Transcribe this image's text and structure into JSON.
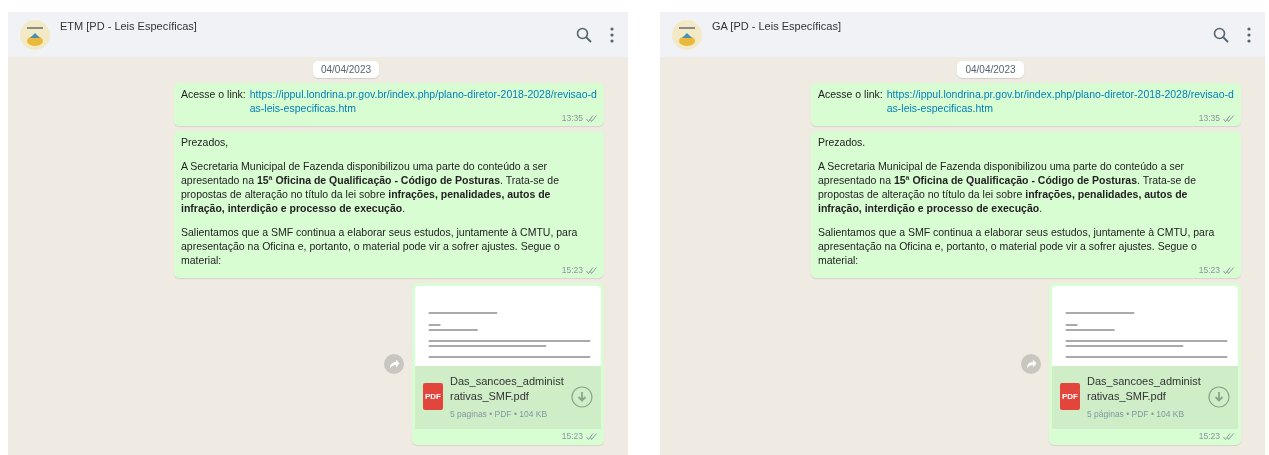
{
  "panels": [
    {
      "header": {
        "title": "ETM [PD - Leis Específicas]"
      },
      "date_chip": "04/04/2023",
      "messages": [
        {
          "kind": "link",
          "prefix": "Acesse o link:",
          "link": "https://ippul.londrina.pr.gov.br/index.php/plano-diretor-2018-2028/revisao-das-leis-especificas.htm",
          "time": "13:35"
        },
        {
          "kind": "text",
          "paragraphs": [
            "Prezados,",
            "A Secretaria Municipal de Fazenda disponibilizou uma parte do conteúdo a ser apresentado na **15ª Oficina de Qualificação - Código de Posturas**. Trata-se de propostas de alteração no título da lei sobre **infrações, penalidades, autos de infração, interdição e processo de execução**.",
            "Salientamos que a SMF continua a elaborar seus estudos, juntamente à CMTU, para apresentação na Oficina e, portanto, o material pode vir a sofrer ajustes. Segue o material:"
          ],
          "time": "15:23"
        },
        {
          "kind": "document",
          "file_type": "PDF",
          "file_name": "Das_sancoes_administrativas_SMF.pdf",
          "meta": "5 paginas • PDF • 104 KB",
          "time": "15:23"
        }
      ]
    },
    {
      "header": {
        "title": "GA [PD - Leis Específicas]"
      },
      "date_chip": "04/04/2023",
      "messages": [
        {
          "kind": "link",
          "prefix": "Acesse o link:",
          "link": "https://ippul.londrina.pr.gov.br/index.php/plano-diretor-2018-2028/revisao-das-leis-especificas.htm",
          "time": "13:35"
        },
        {
          "kind": "text",
          "paragraphs": [
            "Prezados.",
            "A Secretaria Municipal de Fazenda disponibilizou uma parte do conteúdo a ser apresentado na **15ª Oficina de Qualificação - Código de Posturas**. Trata-se de propostas de alteração no título da lei sobre **infrações, penalidades, autos de infração, interdição e processo de execução**.",
            "Salientamos que a SMF continua a elaborar seus estudos, juntamente à CMTU, para apresentação na Oficina e, portanto, o material pode vir a sofrer ajustes. Segue o material:"
          ],
          "time": "15:23"
        },
        {
          "kind": "document",
          "file_type": "PDF",
          "file_name": "Das_sancoes_administrativas_SMF.pdf",
          "meta": "5 páginas • PDF • 104 KB",
          "time": "15:23"
        }
      ]
    }
  ]
}
